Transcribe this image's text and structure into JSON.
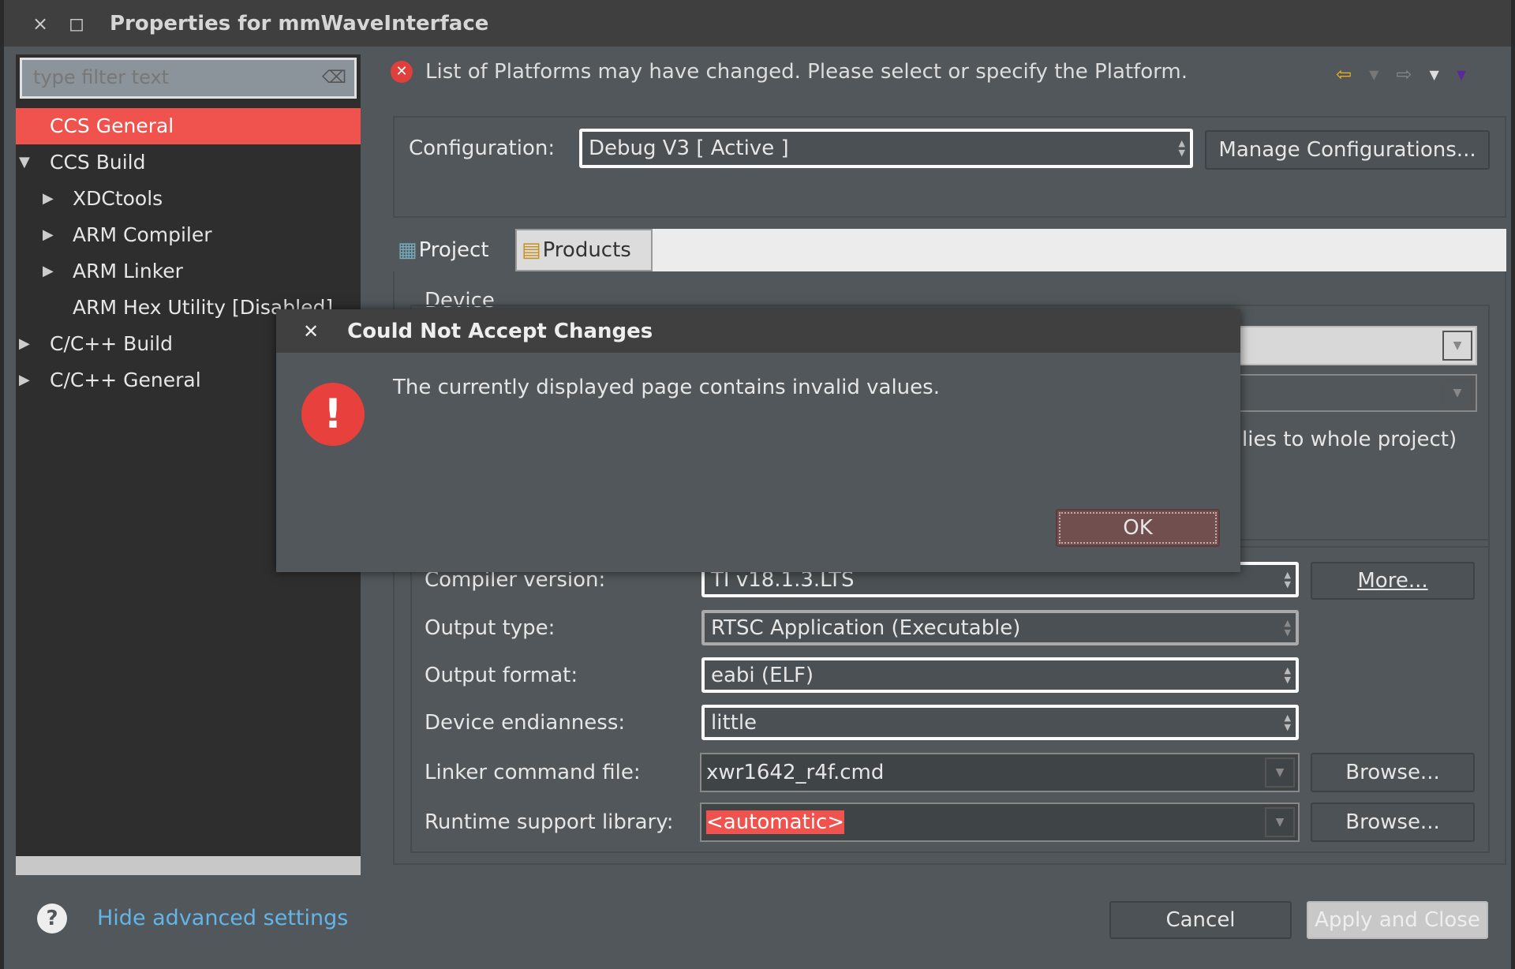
{
  "window": {
    "title": "Properties for mmWaveInterface",
    "close_icon": "×",
    "max_icon": "◻"
  },
  "sidebar": {
    "filter_placeholder": "type filter text",
    "items": [
      {
        "label": "CCS General",
        "selected": true
      },
      {
        "label": "CCS Build",
        "expanded": true
      },
      {
        "label": "XDCtools"
      },
      {
        "label": "ARM Compiler"
      },
      {
        "label": "ARM Linker"
      },
      {
        "label": "ARM Hex Utility  [Disabled]"
      },
      {
        "label": "C/C++ Build"
      },
      {
        "label": "C/C++ General"
      }
    ]
  },
  "message": {
    "text": "List of Platforms may have changed. Please select or specify the Platform.",
    "icon": "error-icon"
  },
  "config": {
    "label": "Configuration:",
    "value": "Debug V3  [ Active ]",
    "manage_label": "Manage Configurations..."
  },
  "tabs": [
    {
      "label": "Project"
    },
    {
      "label": "Products"
    }
  ],
  "project": {
    "device_label": "Device",
    "partial_text": "lies to whole project)",
    "rows": [
      {
        "label": "Compiler version:",
        "value": "TI v18.1.3.LTS",
        "button": "More..."
      },
      {
        "label": "Output type:",
        "value": "RTSC Application (Executable)"
      },
      {
        "label": "Output format:",
        "value": "eabi (ELF)"
      },
      {
        "label": "Device endianness:",
        "value": "little"
      },
      {
        "label": "Linker command file:",
        "value": "xwr1642_r4f.cmd",
        "button": "Browse..."
      },
      {
        "label": "Runtime support library:",
        "value": "<automatic>",
        "button": "Browse..."
      }
    ]
  },
  "dialog": {
    "title": "Could Not Accept Changes",
    "message": "The currently displayed page contains invalid values.",
    "ok": "OK",
    "icon": "!"
  },
  "footer": {
    "help": "?",
    "hide_advanced": "Hide advanced settings",
    "cancel": "Cancel",
    "apply": "Apply and Close"
  },
  "colors": {
    "accent": "#f0524d",
    "link": "#63b5e8"
  }
}
